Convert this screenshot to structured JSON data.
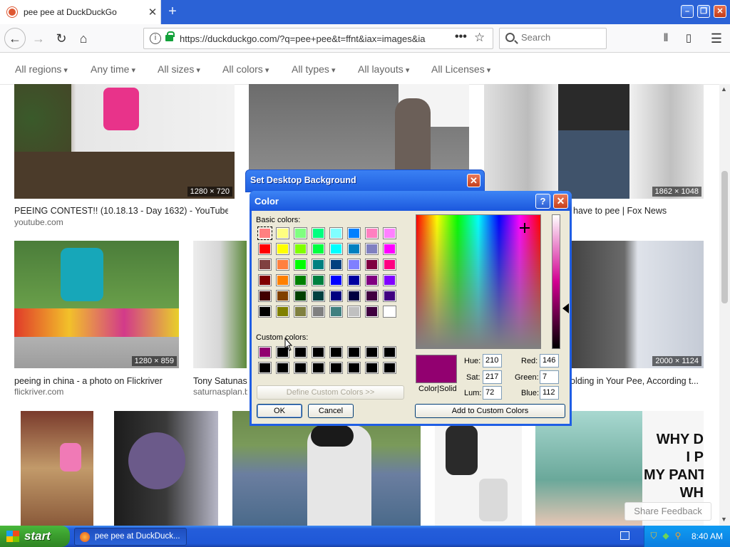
{
  "browser": {
    "tab_title": "pee pee at DuckDuckGo",
    "tab_close": "✕",
    "new_tab": "+",
    "url": "https://duckduckgo.com/?q=pee+pee&t=ffnt&iax=images&ia",
    "search_placeholder": "Search",
    "more": "•••",
    "bookmark": "☆"
  },
  "window_buttons": {
    "minimize": "–",
    "restore": "❐",
    "close": "✕"
  },
  "filters": [
    "All regions",
    "Any time",
    "All sizes",
    "All colors",
    "All types",
    "All layouts",
    "All Licenses"
  ],
  "results": {
    "row1": [
      {
        "dim": "1280 × 720",
        "title": "PEEING CONTEST!! (10.18.13 - Day 1632) - YouTube",
        "src": "youtube.com"
      },
      {
        "dim": "",
        "title": "",
        "src": ""
      },
      {
        "dim": "1862 × 1048",
        "title": "have to pee | Fox News",
        "src": ""
      }
    ],
    "row2": [
      {
        "dim": "1280 × 859",
        "title": "peeing in china - a photo on Flickriver",
        "src": "flickriver.com"
      },
      {
        "dim": "",
        "title": "Tony Satunas",
        "src": "saturnasplan.b"
      },
      {
        "dim": "2000 × 1124",
        "title": "olding in Your Pee, According t...",
        "src": ""
      }
    ],
    "row3_caption": "WHY D\nI P\nMY PANT\nWH"
  },
  "share_feedback": "Share Feedback",
  "sdb_dialog": {
    "title": "Set Desktop Background",
    "close": "✕"
  },
  "color_dialog": {
    "title": "Color",
    "help": "?",
    "close": "✕",
    "basic_label": "Basic colors:",
    "custom_label": "Custom colors:",
    "define_btn": "Define Custom Colors >>",
    "ok_btn": "OK",
    "cancel_btn": "Cancel",
    "add_btn": "Add to Custom Colors",
    "color_solid": "Color|Solid",
    "hue_label": "Hue:",
    "hue": "210",
    "sat_label": "Sat:",
    "sat": "217",
    "lum_label": "Lum:",
    "lum": "72",
    "red_label": "Red:",
    "red": "146",
    "green_label": "Green:",
    "green": "7",
    "blue_label": "Blue:",
    "blue": "112",
    "basic_colors": [
      "#ff8080",
      "#ffff80",
      "#80ff80",
      "#00ff80",
      "#80ffff",
      "#0080ff",
      "#ff80c0",
      "#ff80ff",
      "#ff0000",
      "#ffff00",
      "#80ff00",
      "#00ff40",
      "#00ffff",
      "#0080c0",
      "#8080c0",
      "#ff00ff",
      "#804040",
      "#ff8040",
      "#00ff00",
      "#008080",
      "#004080",
      "#8080ff",
      "#800040",
      "#ff0080",
      "#800000",
      "#ff8000",
      "#008000",
      "#008040",
      "#0000ff",
      "#0000a0",
      "#800080",
      "#8000ff",
      "#400000",
      "#804000",
      "#004000",
      "#004040",
      "#000080",
      "#000040",
      "#400040",
      "#400080",
      "#000000",
      "#808000",
      "#808040",
      "#808080",
      "#408080",
      "#c0c0c0",
      "#400040",
      "#ffffff"
    ],
    "custom_colors": [
      "#920070",
      "#000000",
      "#000000",
      "#000000",
      "#000000",
      "#000000",
      "#000000",
      "#000000",
      "#000000",
      "#000000",
      "#000000",
      "#000000",
      "#000000",
      "#000000",
      "#000000",
      "#000000"
    ],
    "current_color": "#920070"
  },
  "taskbar": {
    "start": "start",
    "task_item": "pee pee at DuckDuck...",
    "clock": "8:40 AM"
  }
}
